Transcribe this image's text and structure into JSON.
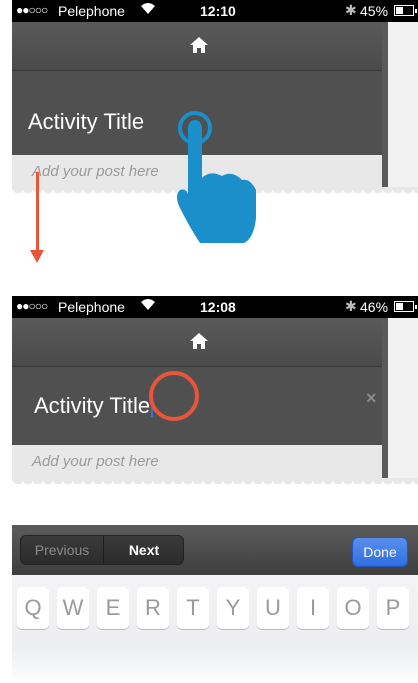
{
  "top_screen": {
    "status_bar": {
      "signal_dots": "●●○○○",
      "carrier": "Pelephone",
      "time": "12:10",
      "battery_percent": "45%",
      "battery_level": 0.45
    },
    "title": "Activity Title",
    "post_placeholder": "Add your post here"
  },
  "bottom_screen": {
    "status_bar": {
      "signal_dots": "●●○○○",
      "carrier": "Pelephone",
      "time": "12:08",
      "battery_percent": "46%",
      "battery_level": 0.46
    },
    "title": "Activity Title",
    "clear_symbol": "×",
    "post_placeholder": "Add your post here",
    "accessory": {
      "previous": "Previous",
      "next": "Next",
      "done": "Done"
    },
    "keyboard_row1": [
      "Q",
      "W",
      "E",
      "R",
      "T",
      "Y",
      "U",
      "I",
      "O",
      "P"
    ]
  },
  "colors": {
    "accent_orange": "#e8553b",
    "hand_blue": "#1a8fc9",
    "done_blue": "#2f6fe0",
    "cursor_blue": "#3b6fe6"
  },
  "icons": {
    "home": "home-icon",
    "wifi": "wifi-icon",
    "bluetooth": "bluetooth-icon",
    "battery": "battery-icon",
    "pointer": "tap-hand-icon",
    "arrow": "down-arrow-icon"
  }
}
